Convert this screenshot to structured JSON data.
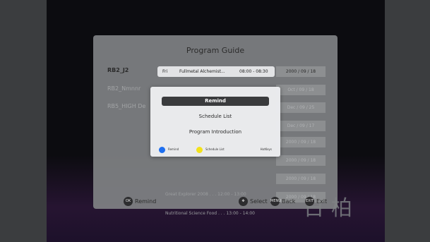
{
  "colors": {
    "background_side": "#3b3d3f",
    "panel": "#808284",
    "popup": "#ecedef",
    "selected_item": "#3a3b3d",
    "blue_dot": "#1e6ff0",
    "yellow_dot": "#f3e21a"
  },
  "guide": {
    "title": "Program Guide",
    "channels": [
      "RB2_J2",
      "RB2_Nmnnr",
      "RB5_HIGH De"
    ],
    "selected_program": {
      "day": "Fri",
      "name": "Fullmetal Alchemist...",
      "time": "08:00 - 08:30"
    },
    "dates": [
      "2000 / 09 / 18",
      "Oct / 09 / 18",
      "Dec / 09 / 25",
      "Dec / 09 / 17",
      "2000 / 09 / 18",
      "2000 / 09 / 18",
      "2000 / 09 / 18",
      "2000 / 09 / 18"
    ]
  },
  "popup": {
    "menu": [
      "Remind",
      "Schedule List",
      "Program Introduction"
    ],
    "legend": {
      "blue_label": "Remind",
      "yellow_label": "Schedule List",
      "hotkeys_label": "HotKeys"
    }
  },
  "footer": {
    "ok_button": "OK",
    "ok_label": "Remind",
    "select_label": "Select",
    "back_button": "MENU",
    "back_label": "Back",
    "exit_button": "EXIT",
    "exit_label": "Exit"
  }
}
